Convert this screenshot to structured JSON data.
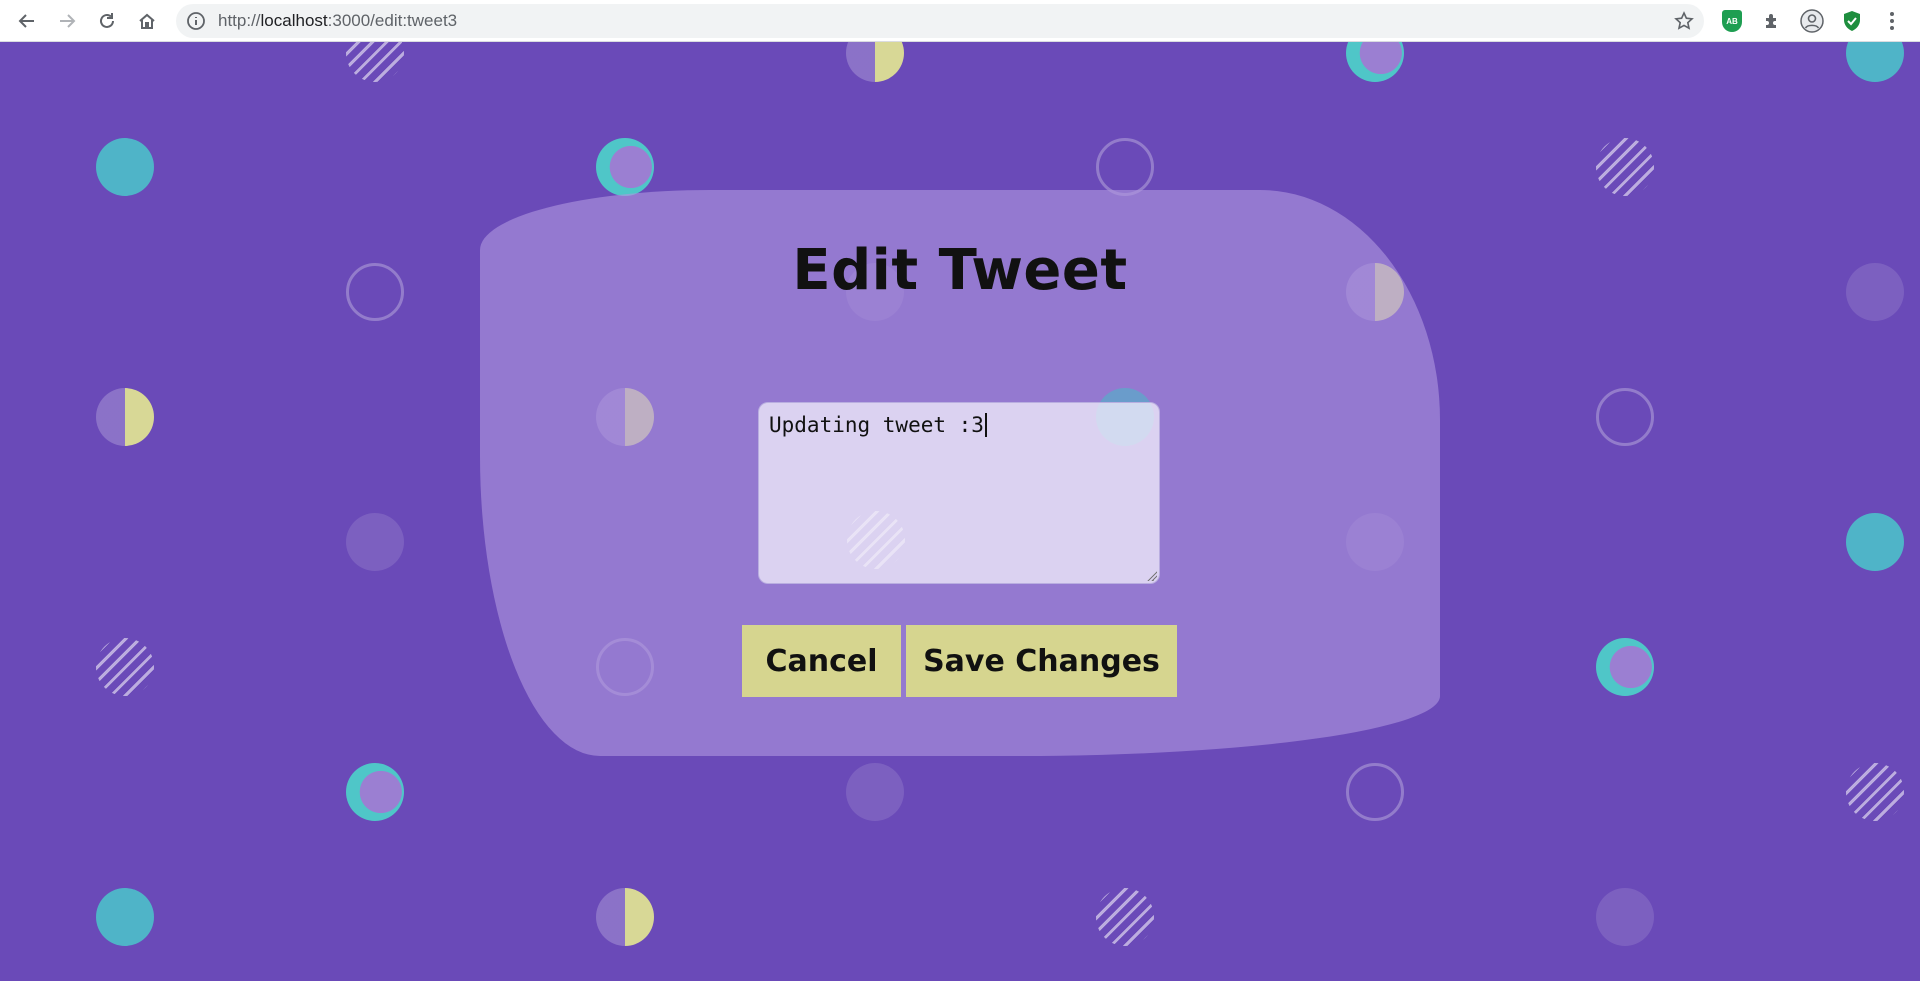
{
  "browser": {
    "url_scheme": "http://",
    "url_host": "localhost",
    "url_rest": ":3000/edit:tweet3",
    "extension_badge": "AB"
  },
  "page": {
    "title": "Edit Tweet",
    "tweet_text": "Updating tweet :3",
    "cancel_label": "Cancel",
    "save_label": "Save Changes"
  },
  "colors": {
    "background": "#6a4ab8",
    "card": "#ae96de",
    "button": "#d6d58f",
    "dot_teal": "#4fb4c8",
    "dot_yellow": "#d8d896"
  }
}
